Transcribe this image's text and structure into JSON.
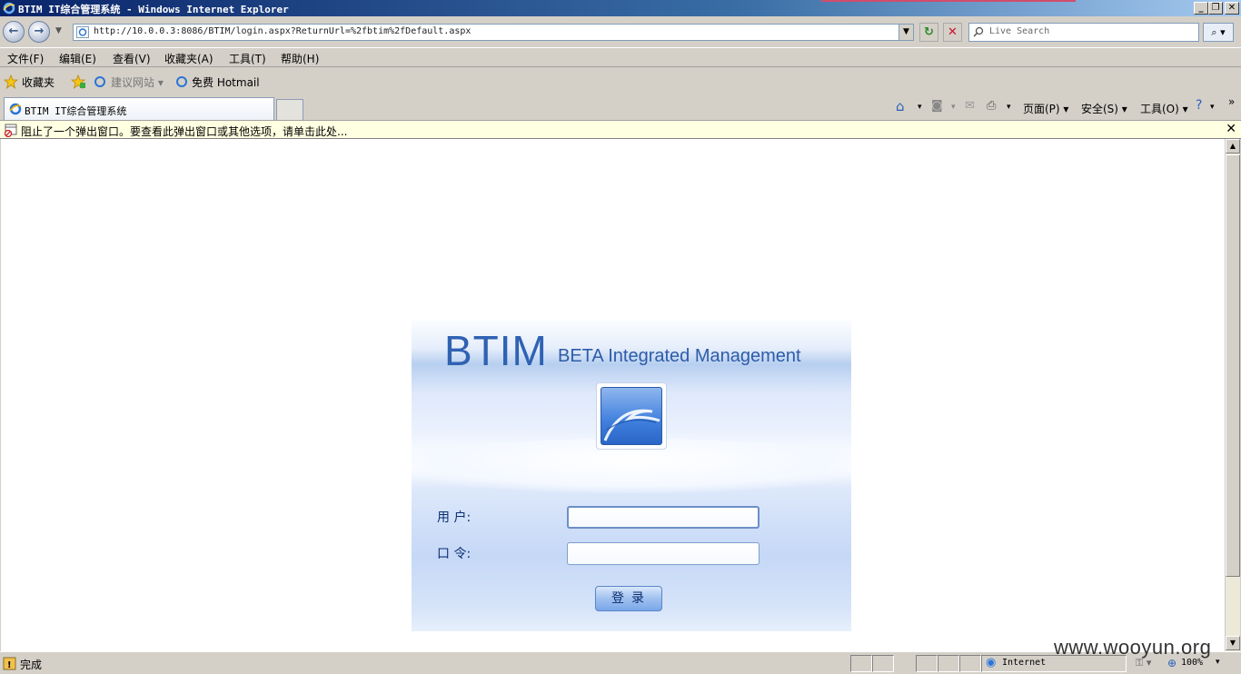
{
  "window": {
    "title": "BTIM IT综合管理系统 - Windows Internet Explorer"
  },
  "address": {
    "url": "http://10.0.0.3:8086/BTIM/login.aspx?ReturnUrl=%2fbtim%2fDefault.aspx"
  },
  "search": {
    "placeholder": "Live Search"
  },
  "menu": {
    "file": "文件(F)",
    "edit": "编辑(E)",
    "view": "查看(V)",
    "favorites": "收藏夹(A)",
    "tools": "工具(T)",
    "help": "帮助(H)"
  },
  "favorites_bar": {
    "favorites": "收藏夹",
    "suggested_sites": "建议网站",
    "hotmail": "免费 Hotmail"
  },
  "tab": {
    "title": "BTIM IT综合管理系统"
  },
  "command_bar": {
    "page": "页面(P)",
    "safety": "安全(S)",
    "tools": "工具(O)"
  },
  "infobar": {
    "message": "阻止了一个弹出窗口。要查看此弹出窗口或其他选项，请单击此处..."
  },
  "login": {
    "brand": "BTIM",
    "brand_subtitle": "BETA Integrated Management",
    "username_label": "用 户:",
    "password_label": "口 令:",
    "submit_label": "登录",
    "username_value": "",
    "password_value": ""
  },
  "status": {
    "text": "完成",
    "zone": "Internet",
    "zoom": "100%"
  },
  "watermark": "www.wooyun.org",
  "colors": {
    "brand": "#2f62b3",
    "titlebar": "#0a246a",
    "infobar": "#ffffe1"
  }
}
